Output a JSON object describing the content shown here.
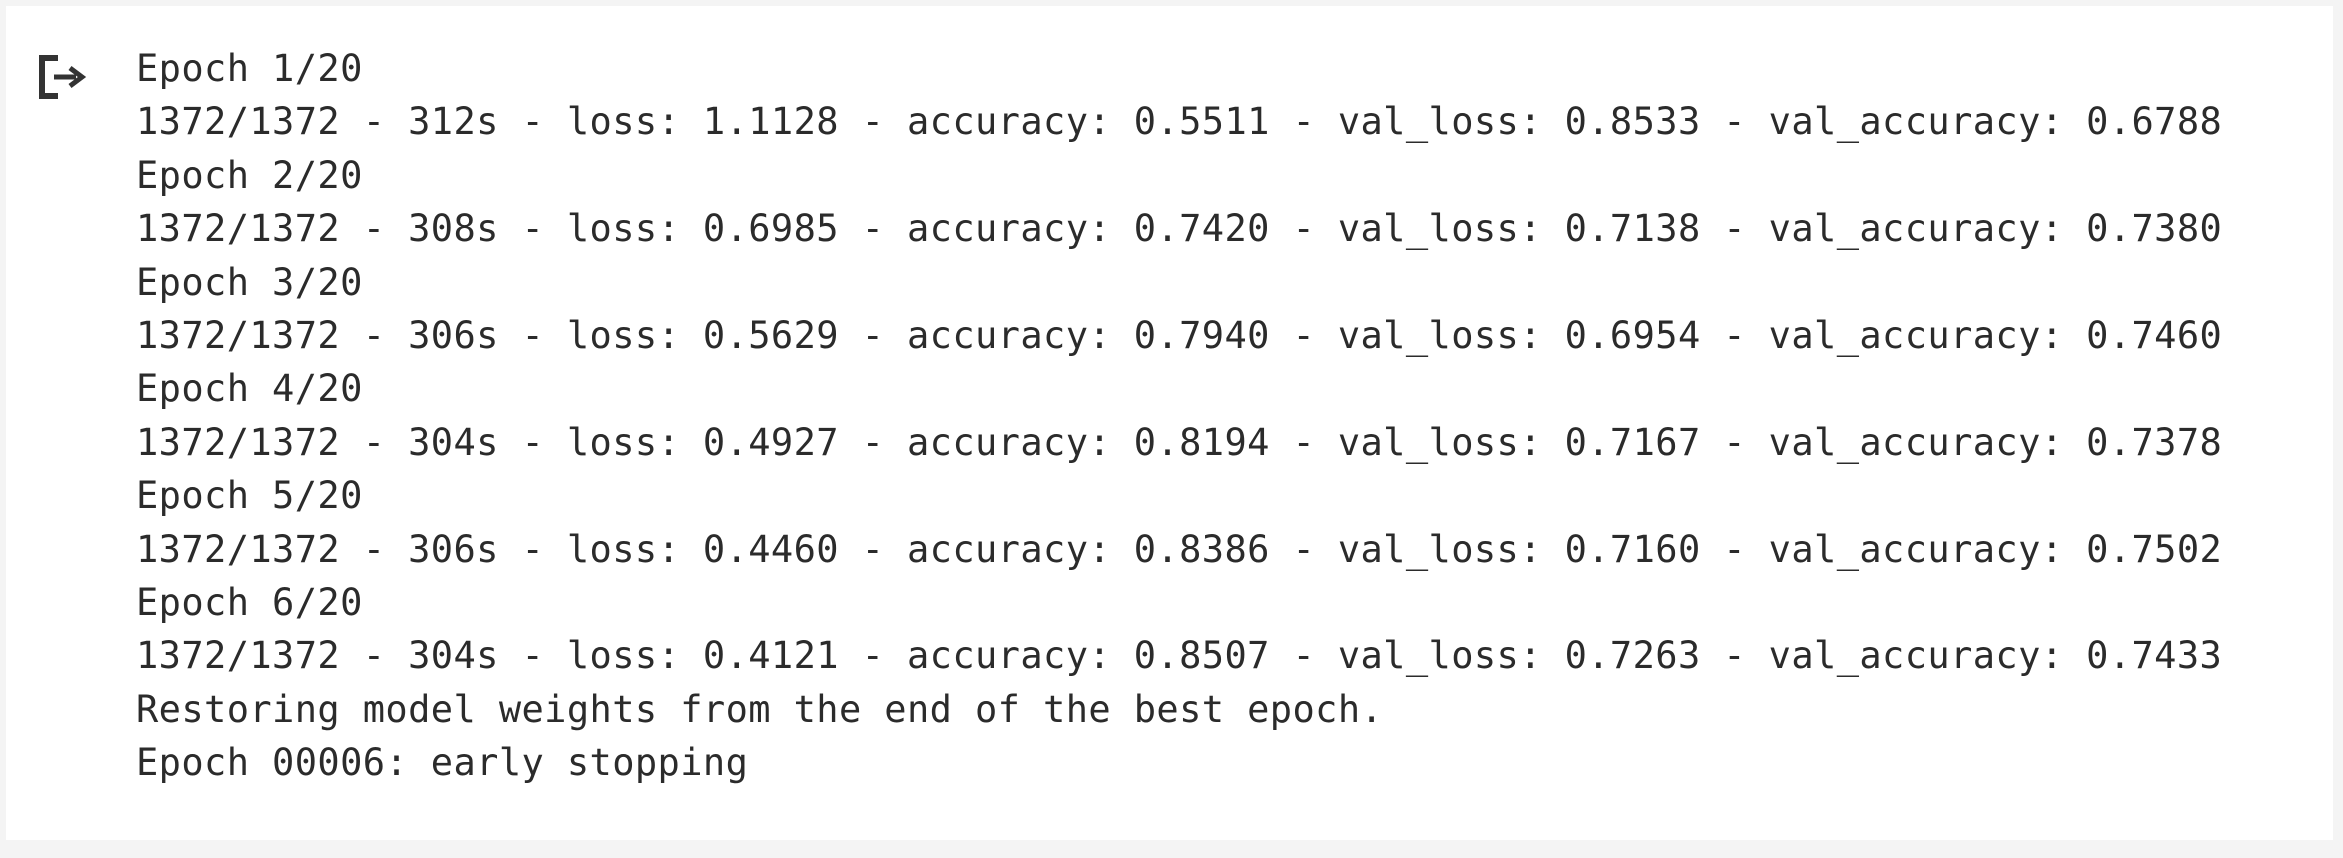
{
  "output": {
    "icon": "output-redirect-icon",
    "lines": [
      "Epoch 1/20",
      "1372/1372 - 312s - loss: 1.1128 - accuracy: 0.5511 - val_loss: 0.8533 - val_accuracy: 0.6788",
      "Epoch 2/20",
      "1372/1372 - 308s - loss: 0.6985 - accuracy: 0.7420 - val_loss: 0.7138 - val_accuracy: 0.7380",
      "Epoch 3/20",
      "1372/1372 - 306s - loss: 0.5629 - accuracy: 0.7940 - val_loss: 0.6954 - val_accuracy: 0.7460",
      "Epoch 4/20",
      "1372/1372 - 304s - loss: 0.4927 - accuracy: 0.8194 - val_loss: 0.7167 - val_accuracy: 0.7378",
      "Epoch 5/20",
      "1372/1372 - 306s - loss: 0.4460 - accuracy: 0.8386 - val_loss: 0.7160 - val_accuracy: 0.7502",
      "Epoch 6/20",
      "1372/1372 - 304s - loss: 0.4121 - accuracy: 0.8507 - val_loss: 0.7263 - val_accuracy: 0.7433",
      "Restoring model weights from the end of the best epoch.",
      "Epoch 00006: early stopping"
    ]
  },
  "colors": {
    "text": "#2b2b2b",
    "background": "#ffffff",
    "frame": "#f4f4f4"
  }
}
